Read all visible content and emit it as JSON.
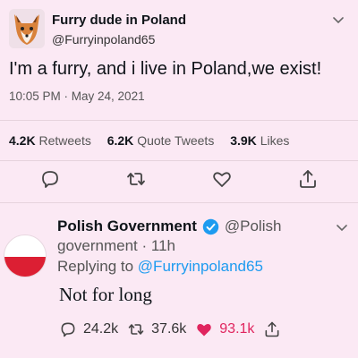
{
  "tweet1": {
    "display_name": "Furry dude in Poland",
    "handle": "@Furryinpoland65",
    "text": "I'm a furry, and i live in Poland,we exist!",
    "timestamp": "10:05 PM · May 24, 2021",
    "stats": {
      "retweets_count": "4.2K",
      "retweets_label": "Retweets",
      "quotes_count": "6.2K",
      "quotes_label": "Quote Tweets",
      "likes_count": "3.9K",
      "likes_label": "Likes"
    },
    "actions": [
      "reply-icon",
      "retweet-icon",
      "like-icon",
      "share-icon"
    ]
  },
  "tweet2": {
    "display_name": "Polish Government",
    "handle_part1": "@Polish",
    "handle_part2": "government",
    "time": "· 11h",
    "replying_prefix": "Replying to",
    "replying_to": "@Furryinpoland65",
    "text": "Not for long",
    "reply_count": "24.2k",
    "retweet_count": "37.6k",
    "like_count": "93.1k",
    "verified": true
  },
  "colors": {
    "background": "#fbe9f4",
    "accent_blue": "#1d9bf0",
    "like_red": "#e0245e",
    "flag_red": "#dc1f33"
  }
}
